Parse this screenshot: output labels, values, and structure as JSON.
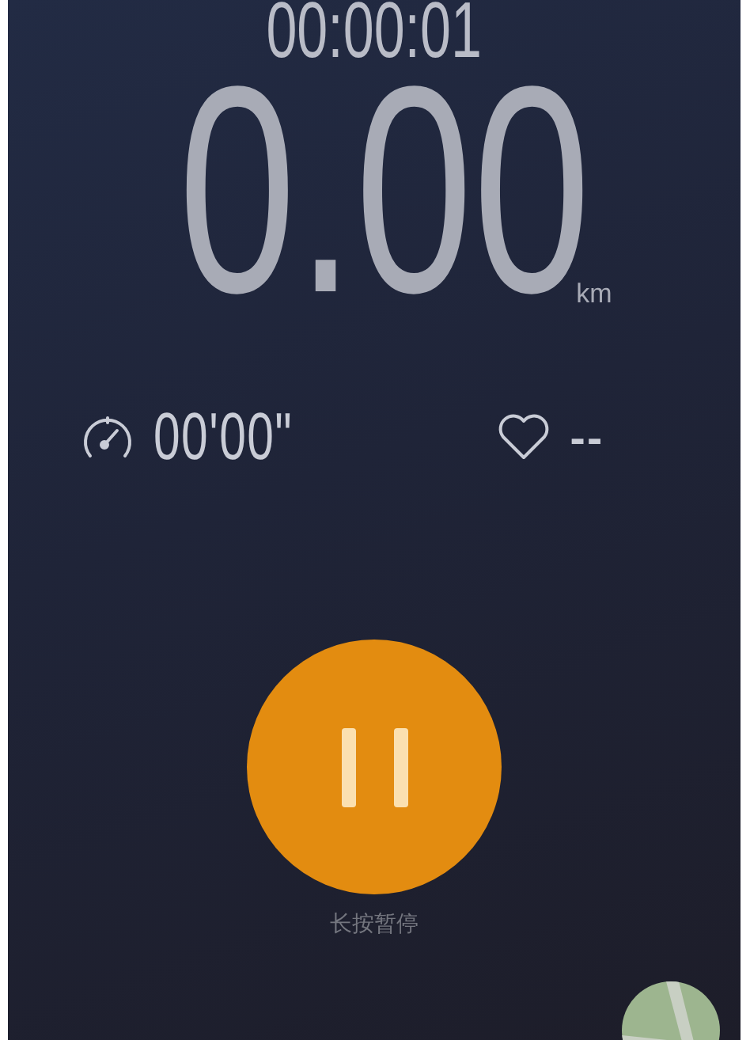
{
  "timer": "00:00:01",
  "distance": {
    "value": "0.00",
    "unit": "km"
  },
  "pace": "00'00\"",
  "heart_rate": "--",
  "pause_button": {
    "hint": "长按暂停"
  }
}
